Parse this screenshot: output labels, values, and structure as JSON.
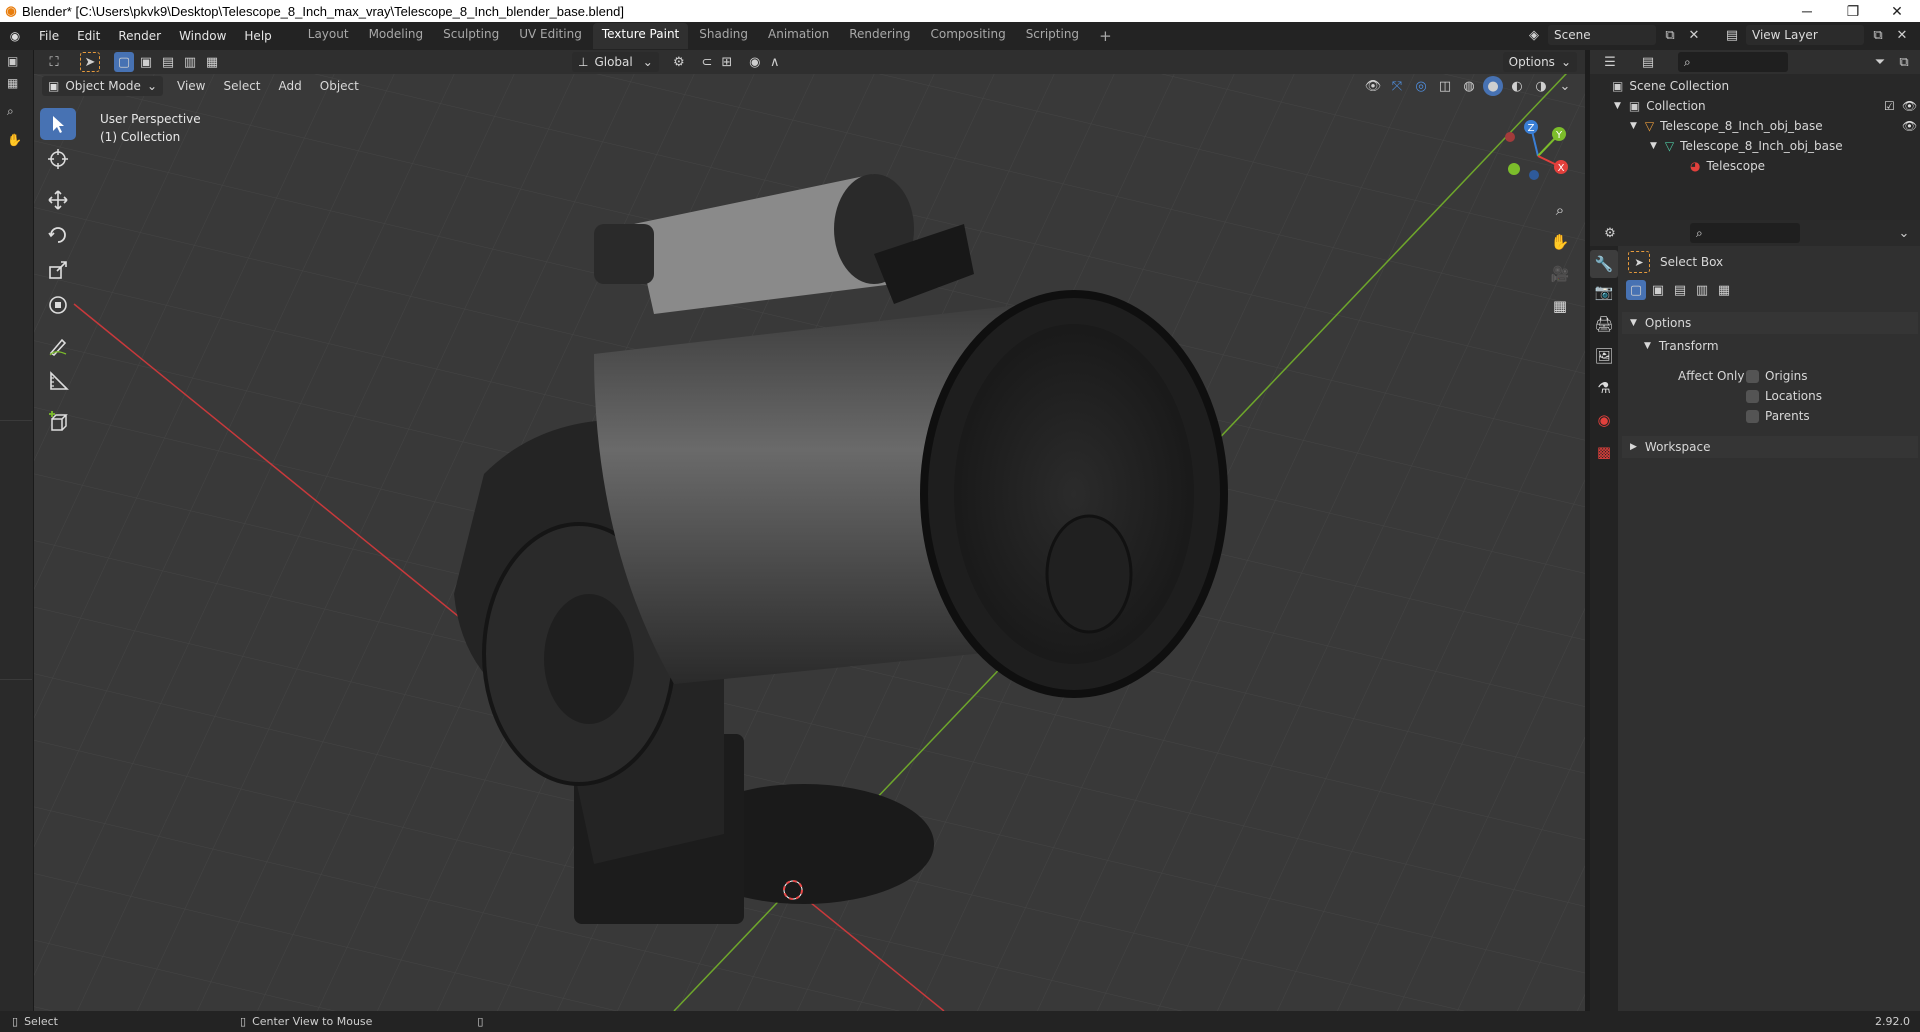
{
  "titlebar": {
    "title": "Blender* [C:\\Users\\pkvk9\\Desktop\\Telescope_8_Inch_max_vray\\Telescope_8_Inch_blender_base.blend]",
    "minimize": "─",
    "maximize": "❐",
    "close": "✕"
  },
  "menu": {
    "file": "File",
    "edit": "Edit",
    "render": "Render",
    "window": "Window",
    "help": "Help"
  },
  "workspaces": [
    "Layout",
    "Modeling",
    "Sculpting",
    "UV Editing",
    "Texture Paint",
    "Shading",
    "Animation",
    "Rendering",
    "Compositing",
    "Scripting"
  ],
  "workspace_active": "Texture Paint",
  "scene": {
    "label": "Scene",
    "view_layer": "View Layer"
  },
  "viewport_header": {
    "mode": "Object Mode",
    "view": "View",
    "select": "Select",
    "add": "Add",
    "object": "Object",
    "orientation": "Global",
    "options": "Options"
  },
  "viewport": {
    "perspective": "User Perspective",
    "collection": "(1) Collection",
    "gizmo_axes": [
      "Z",
      "Y",
      "X"
    ]
  },
  "outliner": {
    "root": "Scene Collection",
    "items": [
      {
        "label": "Collection"
      },
      {
        "label": "Telescope_8_Inch_obj_base"
      },
      {
        "label": "Telescope_8_Inch_obj_base"
      },
      {
        "label": "Telescope"
      }
    ]
  },
  "properties": {
    "tool_name": "Select Box",
    "options_panel": "Options",
    "transform_panel": "Transform",
    "affect_only": "Affect Only",
    "checkboxes": [
      "Origins",
      "Locations",
      "Parents"
    ],
    "workspace_panel": "Workspace"
  },
  "statusbar": {
    "left": "Select",
    "middle": "Center View to Mouse",
    "version": "2.92.0"
  },
  "colors": {
    "accent_blue": "#4772b3",
    "axis_x": "#e2403c",
    "axis_y": "#7cbd2b",
    "axis_z": "#3a7fd6",
    "orange_object": "#e69a3c",
    "mesh_green": "#4ec5a0"
  }
}
